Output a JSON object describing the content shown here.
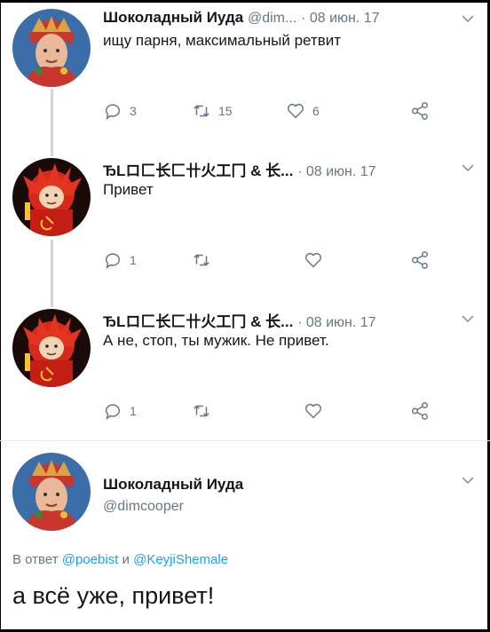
{
  "tweets": [
    {
      "name": "Шоколадный Иуда",
      "handle": "@dim...",
      "date": "· 08 июн. 17",
      "text": "ищу парня, максимальный ретвит",
      "replies": "3",
      "retweets": "15",
      "likes": "6"
    },
    {
      "name": "ЂLロ⼕⻓⼕卄⽕工冂 & ⻓...",
      "date": "· 08 июн. 17",
      "text": "Привет",
      "replies": "1",
      "retweets": "",
      "likes": ""
    },
    {
      "name": "ЂLロ⼕⻓⼕卄⽕工冂 & ⻓...",
      "date": "· 08 июн. 17",
      "text": "А не, стоп, ты мужик. Не привет.",
      "replies": "1",
      "retweets": "",
      "likes": ""
    }
  ],
  "reply": {
    "name": "Шоколадный Иуда",
    "handle": "@dimcooper",
    "reply_prefix": "В ответ",
    "mention1": "@poebist",
    "conj": "и",
    "mention2": "@KeyjiShemale",
    "text": "а всё уже, привет!"
  },
  "colors": {
    "accent": "#1da1f2",
    "muted": "#657786",
    "divider": "#e6ecf0",
    "thread_line": "#ccd6dd"
  }
}
